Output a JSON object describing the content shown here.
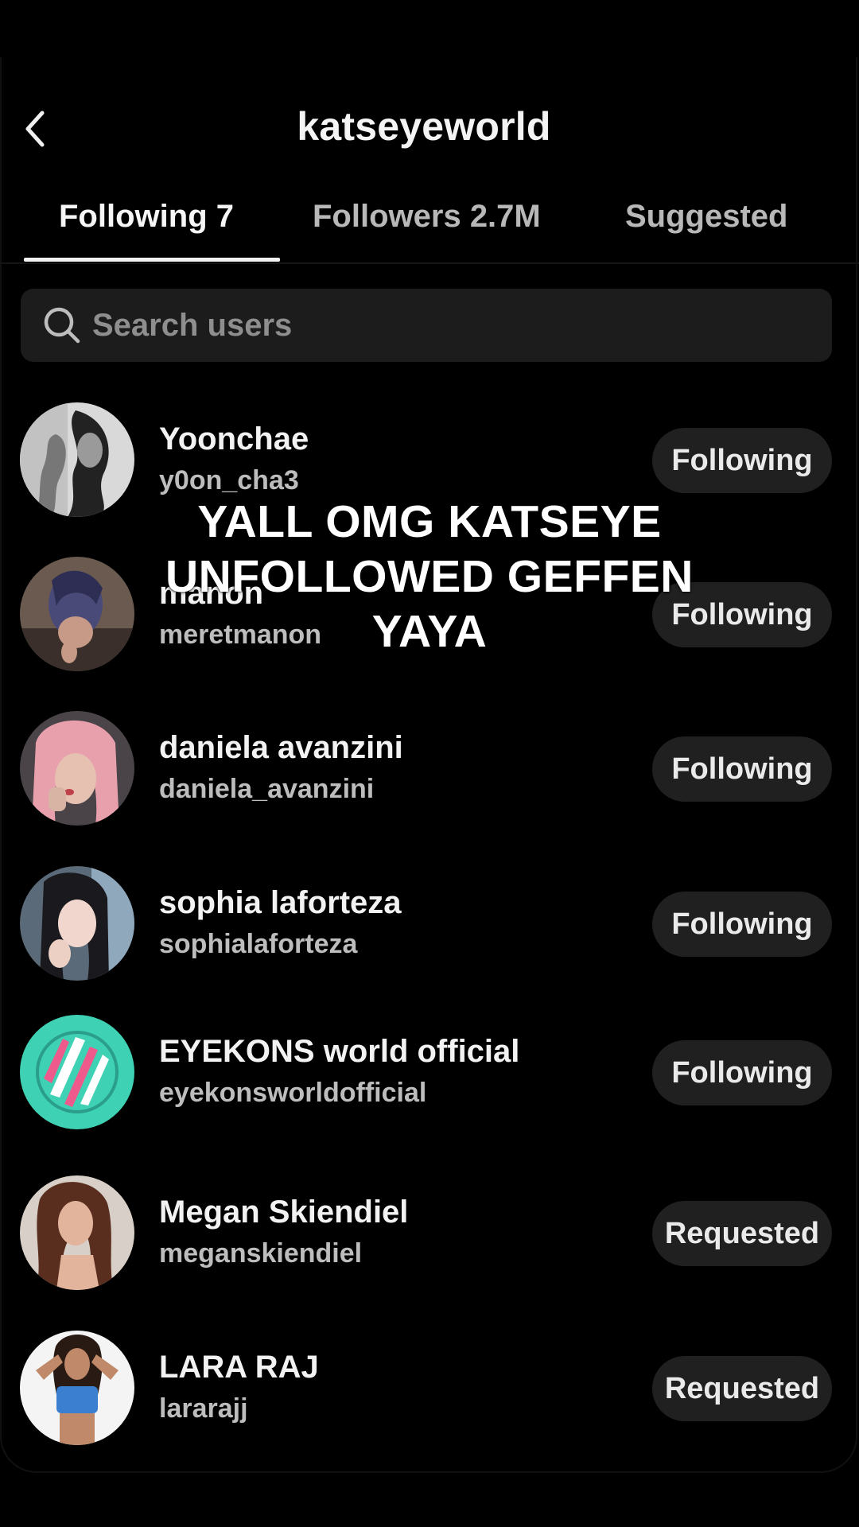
{
  "header": {
    "title": "katseyeworld",
    "back_icon": "chevron-left-icon"
  },
  "tabs": [
    {
      "label": "Following 7",
      "active": true
    },
    {
      "label": "Followers 2.7M",
      "active": false
    },
    {
      "label": "Suggested",
      "active": false
    }
  ],
  "search": {
    "placeholder": "Search users",
    "value": "",
    "icon": "search-icon"
  },
  "users": [
    {
      "display_name": "Yoonchae",
      "username": "y0on_cha3",
      "button": "Following",
      "avatar": "grayscale-photo"
    },
    {
      "display_name": "manon",
      "username": "meretmanon",
      "button": "Following",
      "avatar": "photo"
    },
    {
      "display_name": "daniela avanzini",
      "username": "daniela_avanzini",
      "button": "Following",
      "avatar": "photo"
    },
    {
      "display_name": "sophia laforteza",
      "username": "sophialaforteza",
      "button": "Following",
      "avatar": "photo"
    },
    {
      "display_name": "EYEKONS world official",
      "username": "eyekonsworldofficial",
      "button": "Following",
      "avatar": "eyekons-logo"
    },
    {
      "display_name": "Megan Skiendiel",
      "username": "meganskiendiel",
      "button": "Requested",
      "avatar": "photo"
    },
    {
      "display_name": "LARA RAJ",
      "username": "lararajj",
      "button": "Requested",
      "avatar": "photo"
    }
  ],
  "overlay": {
    "lines": [
      "YALL OMG KATSEYE",
      "UNFOLLOWED GEFFEN",
      "YAYA"
    ]
  },
  "colors": {
    "background": "#000000",
    "button_bg": "#202020",
    "search_bg": "#1c1c1c",
    "eyekons_teal": "#3fd1b4",
    "eyekons_pink": "#ef5a8c"
  }
}
